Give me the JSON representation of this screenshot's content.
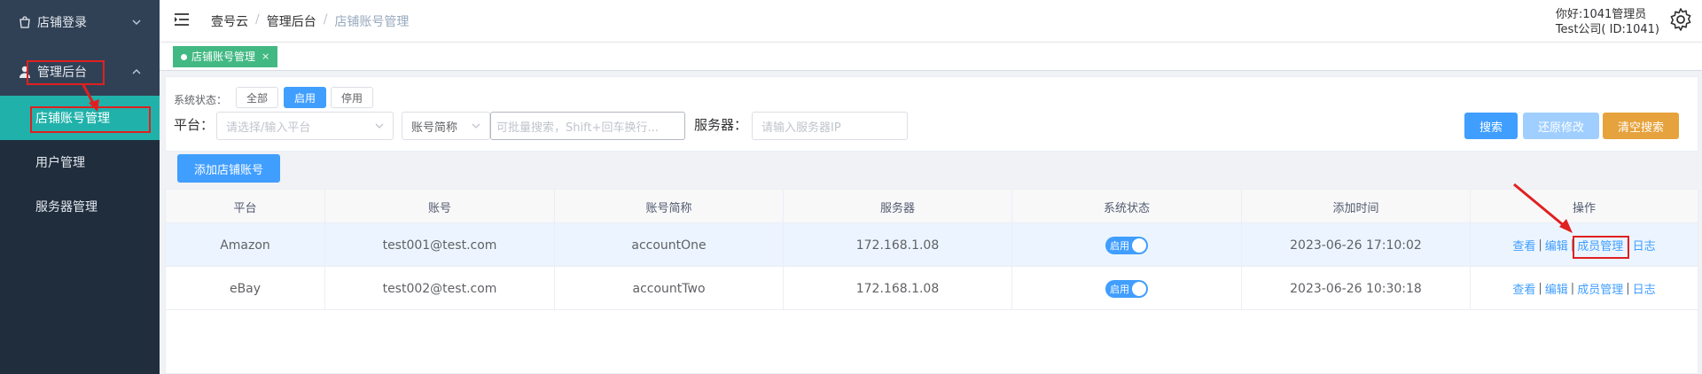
{
  "sidebar": {
    "menu": [
      {
        "label": "店铺登录",
        "icon": "shopping-bag-icon",
        "chevron": "chevron-down"
      },
      {
        "label": "管理后台",
        "icon": "user-icon",
        "chevron": "chevron-up"
      }
    ],
    "subitems": [
      {
        "label": "店铺账号管理",
        "active": true
      },
      {
        "label": "用户管理",
        "active": false
      },
      {
        "label": "服务器管理",
        "active": false
      }
    ]
  },
  "header": {
    "breadcrumb": [
      "壹号云",
      "管理后台",
      "店铺账号管理"
    ],
    "greeting": "你好:1041管理员",
    "company": "Test公司( ID:1041)"
  },
  "tags": {
    "active_tag": "店铺账号管理",
    "close": "×"
  },
  "filters": {
    "status_label": "系统状态：",
    "status_options": [
      "全部",
      "启用",
      "停用"
    ],
    "status_selected": "启用",
    "platform_label": "平台：",
    "platform_placeholder": "请选择/输入平台",
    "field_select": "账号简称",
    "search_placeholder": "可批量搜索，Shift+回车换行...",
    "server_label": "服务器：",
    "server_placeholder": "请输入服务器IP",
    "search_btn": "搜索",
    "restore_btn": "还原修改",
    "clear_btn": "清空搜索",
    "add_btn": "添加店铺账号"
  },
  "table": {
    "columns": [
      "平台",
      "账号",
      "账号简称",
      "服务器",
      "系统状态",
      "添加时间",
      "操作"
    ],
    "rows": [
      {
        "platform": "Amazon",
        "account": "test001@test.com",
        "alias": "accountOne",
        "server": "172.168.1.08",
        "status": "启用",
        "added": "2023-06-26 17:10:02"
      },
      {
        "platform": "eBay",
        "account": "test002@test.com",
        "alias": "accountTwo",
        "server": "172.168.1.08",
        "status": "启用",
        "added": "2023-06-26 10:30:18"
      }
    ],
    "ops": [
      "查看",
      "编辑",
      "成员管理",
      "日志"
    ],
    "op_sep": "|"
  },
  "colors": {
    "sidebar": "#304156",
    "active_menu": "#20b2aa",
    "primary": "#409eff",
    "warning": "#e6a23c",
    "tag": "#42b983",
    "annotation": "#e02020"
  }
}
